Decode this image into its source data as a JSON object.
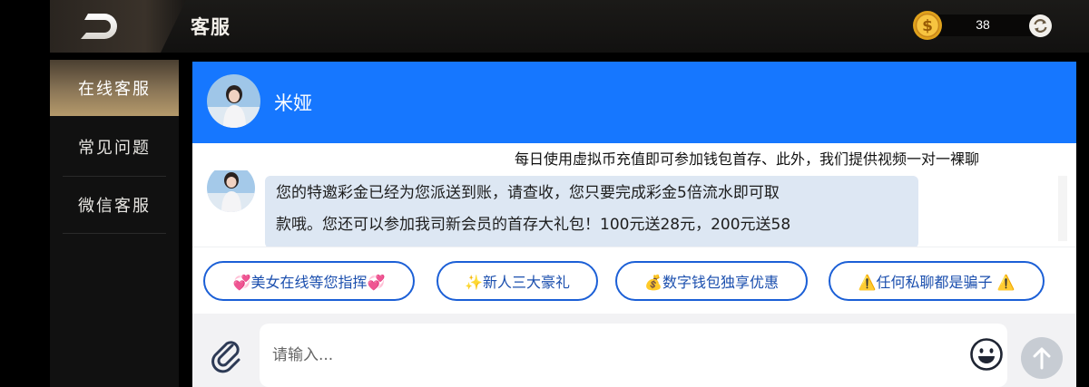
{
  "header": {
    "title": "客服",
    "balance": "38"
  },
  "sidebar": {
    "items": [
      {
        "label": "在线客服",
        "active": true
      },
      {
        "label": "常见问题",
        "active": false
      },
      {
        "label": "微信客服",
        "active": false
      }
    ]
  },
  "chat": {
    "agent_name": "米娅",
    "notice": "每日使用虚拟币充值即可参加钱包首存、此外，我们提供视频一对一裸聊",
    "message_lines": [
      "您的特邀彩金已经为您派送到账，请查收，您只要完成彩金5倍流水即可取",
      "款哦。您还可以参加我司新会员的首存大礼包！100元送28元，200元送58"
    ],
    "quick_replies": [
      "💞美女在线等您指挥💞",
      "✨新人三大豪礼",
      "💰数字钱包独享优惠",
      "⚠️任何私聊都是骗子 ⚠️"
    ],
    "input_placeholder": "请输入...",
    "input_value": ""
  },
  "colors": {
    "header_blue": "#1677ff",
    "gold": "#b59a6b",
    "quick_border": "#1b5fd6",
    "bubble_bg": "#dde7f3"
  },
  "icons": [
    "back-icon",
    "coin-icon",
    "refresh-icon",
    "attach-icon",
    "emoji-icon",
    "send-arrow-icon"
  ]
}
